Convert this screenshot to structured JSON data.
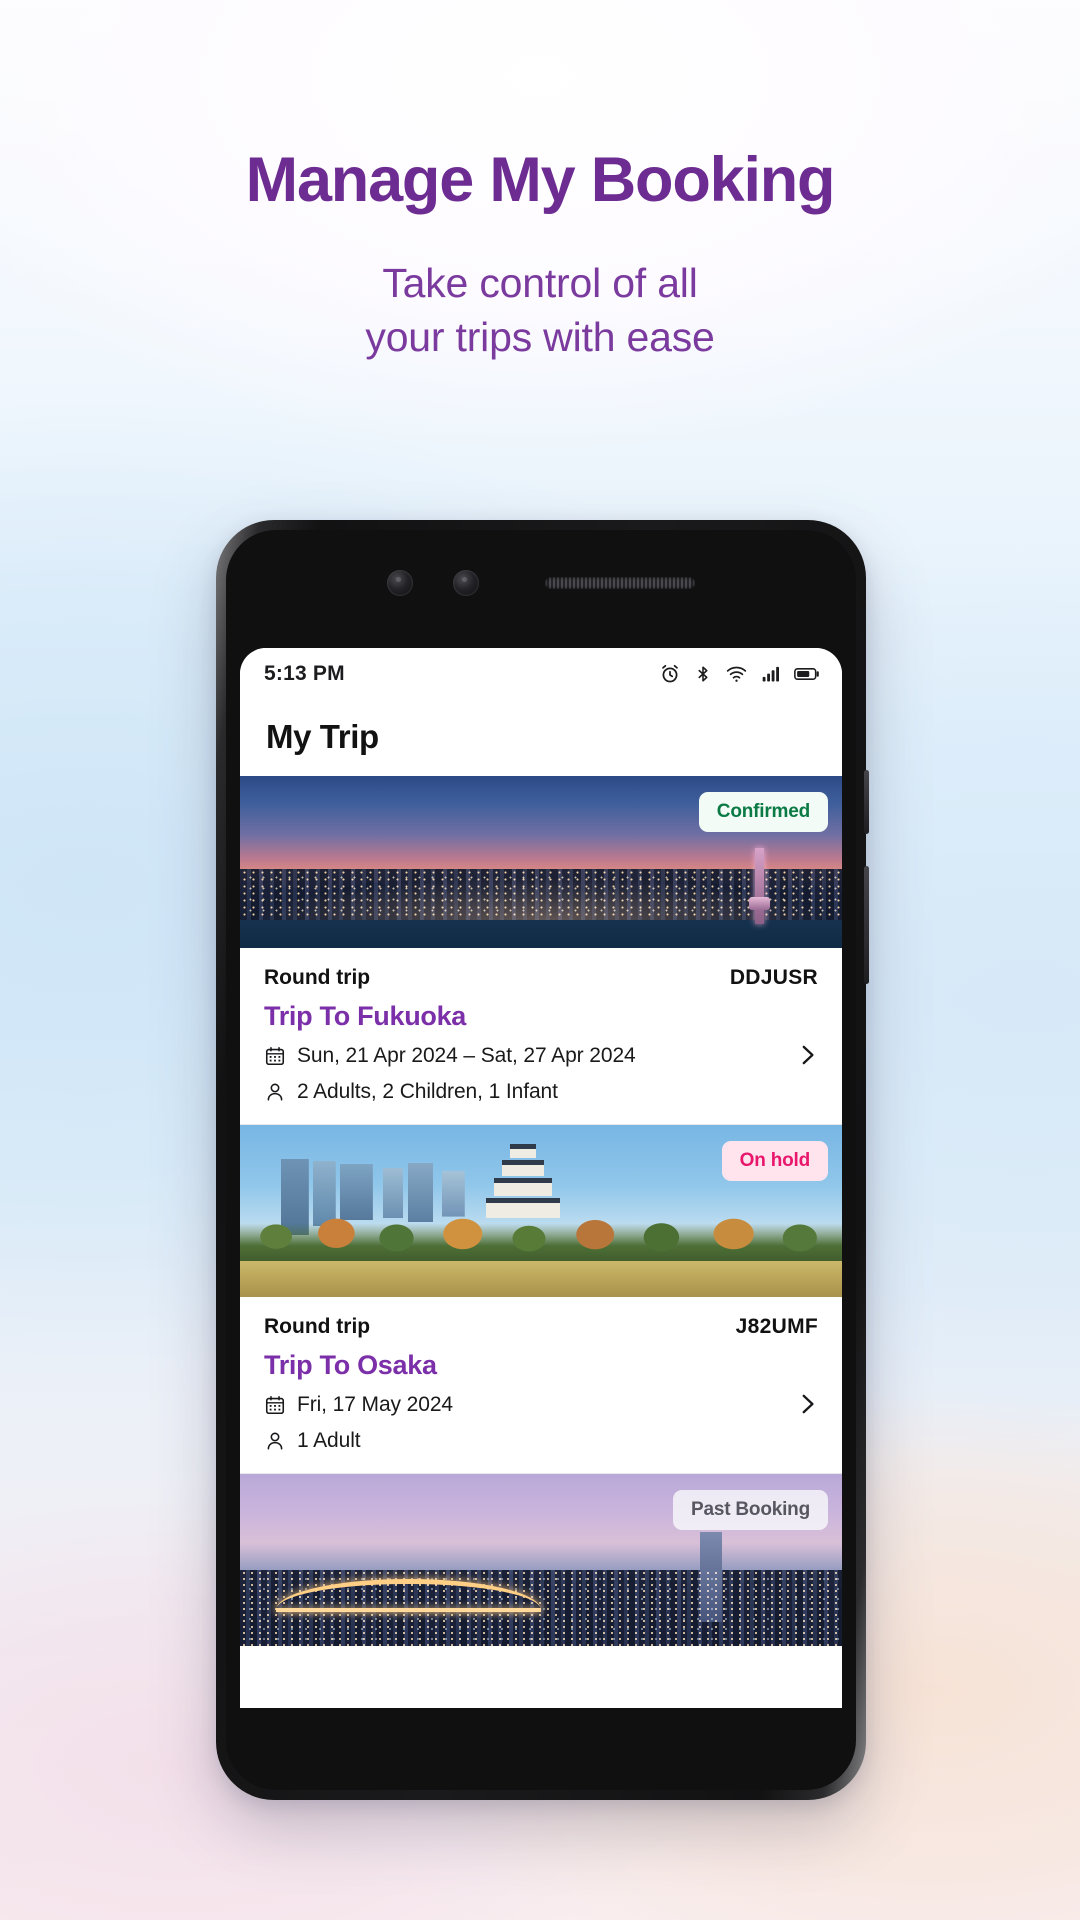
{
  "hero": {
    "title": "Manage My Booking",
    "subtitle_line1": "Take control of all",
    "subtitle_line2": "your trips with ease",
    "title_color": "#6d2c91",
    "subtitle_color": "#7a3a9e"
  },
  "phone": {
    "statusbar": {
      "time": "5:13 PM",
      "icons": [
        "alarm-icon",
        "bluetooth-icon",
        "wifi-icon",
        "cellular-signal-icon",
        "battery-icon"
      ]
    },
    "app": {
      "title": "My Trip"
    }
  },
  "trips": [
    {
      "badge": "Confirmed",
      "badge_type": "confirmed",
      "badge_text_color": "#0b7a45",
      "badge_bg_color": "#f2fbf5",
      "trip_type": "Round trip",
      "pnr": "DDJUSR",
      "name": "Trip To Fukuoka",
      "dates": "Sun, 21 Apr 2024 – Sat, 27 Apr 2024",
      "passengers": "2 Adults, 2 Children, 1 Infant",
      "name_color": "#7b2fa8"
    },
    {
      "badge": "On hold",
      "badge_type": "onhold",
      "badge_text_color": "#e8176b",
      "badge_bg_color": "#ffe4ee",
      "trip_type": "Round trip",
      "pnr": "J82UMF",
      "name": "Trip To Osaka",
      "dates": "Fri, 17 May 2024",
      "passengers": "1 Adult",
      "name_color": "#7b2fa8"
    },
    {
      "badge": "Past Booking",
      "badge_type": "past",
      "badge_text_color": "#575762",
      "badge_bg_color": "#f8f8fa"
    }
  ]
}
